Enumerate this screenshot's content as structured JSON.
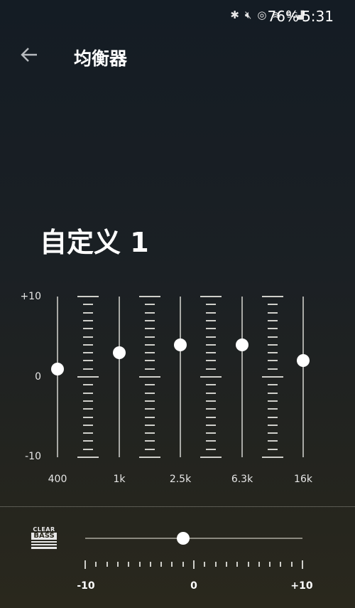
{
  "status_bar": {
    "icons": [
      "bluetooth-icon",
      "mute-icon",
      "hotspot-icon",
      "wifi-icon",
      "signal-5g-icon"
    ],
    "battery": "76%",
    "time": "5:31"
  },
  "header": {
    "title": "均衡器",
    "back_icon": "arrow-left-icon"
  },
  "preset_name": "自定义 1",
  "equalizer": {
    "y_labels": {
      "top": "+10",
      "mid": "0",
      "bottom": "-10"
    },
    "range": [
      -10,
      10
    ],
    "bands": [
      {
        "label": "400",
        "value": 1
      },
      {
        "label": "1k",
        "value": 3
      },
      {
        "label": "2.5k",
        "value": 4
      },
      {
        "label": "6.3k",
        "value": 4
      },
      {
        "label": "16k",
        "value": 2
      }
    ]
  },
  "clear_bass": {
    "logo_top": "CLEAR",
    "logo_bottom": "BASS",
    "value": -1,
    "range": [
      -10,
      10
    ],
    "labels": {
      "min": "-10",
      "mid": "0",
      "max": "+10"
    }
  }
}
